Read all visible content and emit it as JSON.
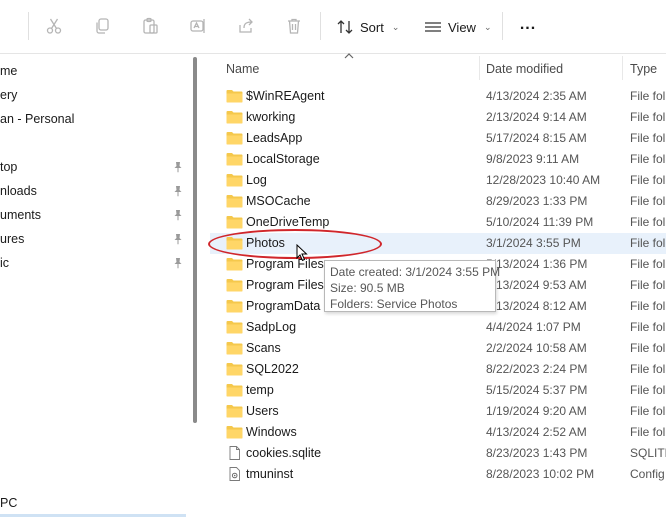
{
  "toolbar": {
    "icons": [
      "cut-icon",
      "copy-icon",
      "paste-icon",
      "rename-icon",
      "share-icon",
      "delete-icon"
    ],
    "sort_label": "Sort",
    "view_label": "View",
    "more_label": "..."
  },
  "sidebar": {
    "items": [
      {
        "label": "me",
        "pinned": false
      },
      {
        "label": "ery",
        "pinned": false
      },
      {
        "label": "an - Personal",
        "pinned": false
      },
      {
        "label": "top",
        "pinned": true
      },
      {
        "label": "nloads",
        "pinned": true
      },
      {
        "label": "uments",
        "pinned": true
      },
      {
        "label": "ures",
        "pinned": true
      },
      {
        "label": "ic",
        "pinned": true
      }
    ],
    "bottom_item": "PC"
  },
  "columns": {
    "name": "Name",
    "date_modified": "Date modified",
    "type": "Type"
  },
  "files": [
    {
      "name": "$WinREAgent",
      "date": "4/13/2024 2:35 AM",
      "type": "File fol",
      "kind": "folder"
    },
    {
      "name": "kworking",
      "date": "2/13/2024 9:14 AM",
      "type": "File fol",
      "kind": "folder"
    },
    {
      "name": "LeadsApp",
      "date": "5/17/2024 8:15 AM",
      "type": "File fol",
      "kind": "folder"
    },
    {
      "name": "LocalStorage",
      "date": "9/8/2023 9:11 AM",
      "type": "File fol",
      "kind": "folder"
    },
    {
      "name": "Log",
      "date": "12/28/2023 10:40 AM",
      "type": "File fol",
      "kind": "folder"
    },
    {
      "name": "MSOCache",
      "date": "8/29/2023 1:33 PM",
      "type": "File fol",
      "kind": "folder"
    },
    {
      "name": "OneDriveTemp",
      "date": "5/10/2024 11:39 PM",
      "type": "File fol",
      "kind": "folder"
    },
    {
      "name": "Photos",
      "date": "3/1/2024 3:55 PM",
      "type": "File fol",
      "kind": "folder",
      "selected": true
    },
    {
      "name": "Program Files",
      "date": "5/13/2024 1:36 PM",
      "type": "File fol",
      "kind": "folder"
    },
    {
      "name": "Program Files (",
      "date": "5/13/2024 9:53 AM",
      "type": "File fol",
      "kind": "folder"
    },
    {
      "name": "ProgramData",
      "date": "5/13/2024 8:12 AM",
      "type": "File fol",
      "kind": "folder"
    },
    {
      "name": "SadpLog",
      "date": "4/4/2024 1:07 PM",
      "type": "File fol",
      "kind": "folder"
    },
    {
      "name": "Scans",
      "date": "2/2/2024 10:58 AM",
      "type": "File fol",
      "kind": "folder"
    },
    {
      "name": "SQL2022",
      "date": "8/22/2023 2:24 PM",
      "type": "File fol",
      "kind": "folder"
    },
    {
      "name": "temp",
      "date": "5/15/2024 5:37 PM",
      "type": "File fol",
      "kind": "folder"
    },
    {
      "name": "Users",
      "date": "1/19/2024 9:20 AM",
      "type": "File fol",
      "kind": "folder"
    },
    {
      "name": "Windows",
      "date": "4/13/2024 2:52 AM",
      "type": "File fol",
      "kind": "folder"
    },
    {
      "name": "cookies.sqlite",
      "date": "8/23/2023 1:43 PM",
      "type": "SQLITE",
      "kind": "file"
    },
    {
      "name": "tmuninst",
      "date": "8/28/2023 10:02 PM",
      "type": "Config",
      "kind": "config"
    }
  ],
  "tooltip": {
    "line1": "Date created: 3/1/2024 3:55 PM",
    "line2": "Size: 90.5 MB",
    "line3": "Folders: Service Photos"
  },
  "colors": {
    "folder": "#f5c84c",
    "selection": "#e8f1fb",
    "annotation": "#d0262b"
  }
}
